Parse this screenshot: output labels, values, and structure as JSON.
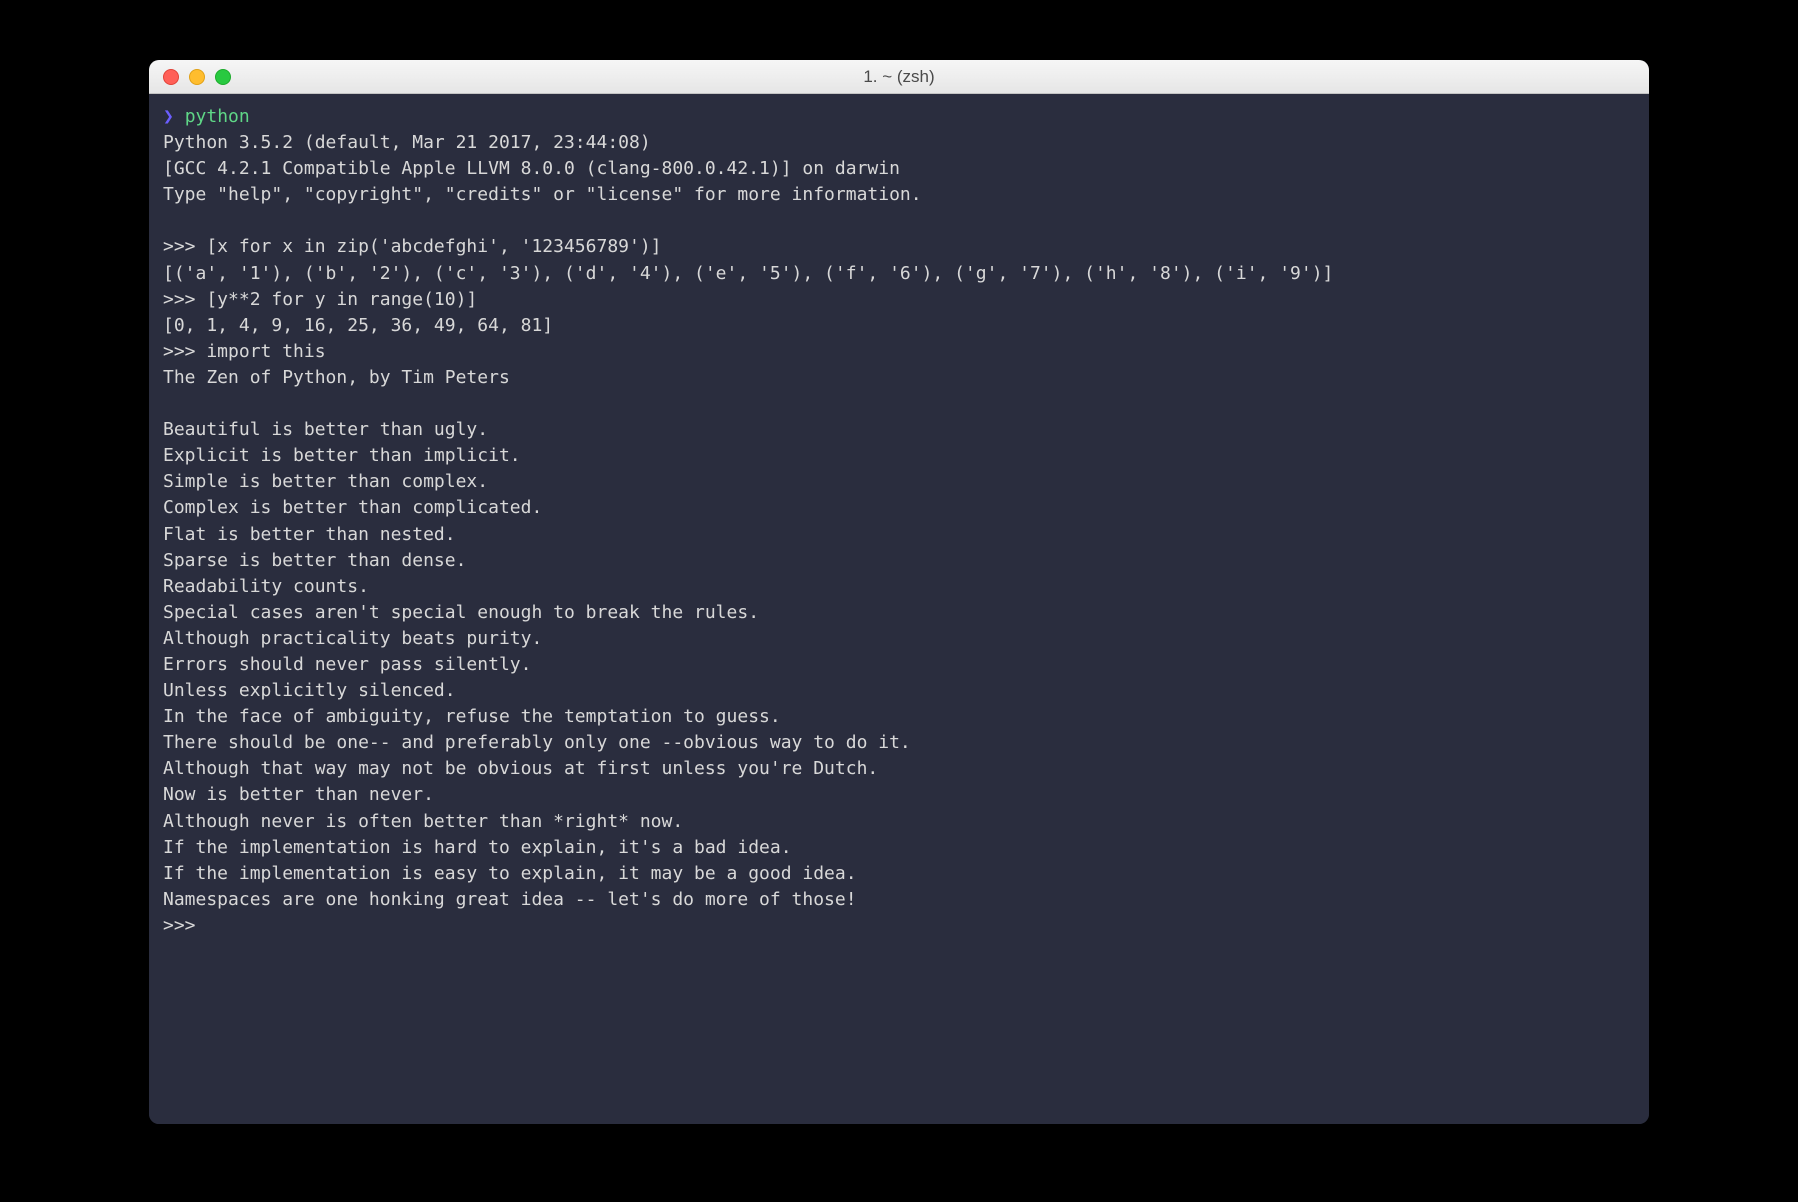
{
  "window": {
    "title": "1. ~ (zsh)"
  },
  "prompt": {
    "arrow": "❯",
    "command": "python"
  },
  "terminal": {
    "lines": [
      "Python 3.5.2 (default, Mar 21 2017, 23:44:08)",
      "[GCC 4.2.1 Compatible Apple LLVM 8.0.0 (clang-800.0.42.1)] on darwin",
      "Type \"help\", \"copyright\", \"credits\" or \"license\" for more information.",
      "",
      ">>> [x for x in zip('abcdefghi', '123456789')]",
      "[('a', '1'), ('b', '2'), ('c', '3'), ('d', '4'), ('e', '5'), ('f', '6'), ('g', '7'), ('h', '8'), ('i', '9')]",
      ">>> [y**2 for y in range(10)]",
      "[0, 1, 4, 9, 16, 25, 36, 49, 64, 81]",
      ">>> import this",
      "The Zen of Python, by Tim Peters",
      "",
      "Beautiful is better than ugly.",
      "Explicit is better than implicit.",
      "Simple is better than complex.",
      "Complex is better than complicated.",
      "Flat is better than nested.",
      "Sparse is better than dense.",
      "Readability counts.",
      "Special cases aren't special enough to break the rules.",
      "Although practicality beats purity.",
      "Errors should never pass silently.",
      "Unless explicitly silenced.",
      "In the face of ambiguity, refuse the temptation to guess.",
      "There should be one-- and preferably only one --obvious way to do it.",
      "Although that way may not be obvious at first unless you're Dutch.",
      "Now is better than never.",
      "Although never is often better than *right* now.",
      "If the implementation is hard to explain, it's a bad idea.",
      "If the implementation is easy to explain, it may be a good idea.",
      "Namespaces are one honking great idea -- let's do more of those!",
      ">>>"
    ]
  }
}
